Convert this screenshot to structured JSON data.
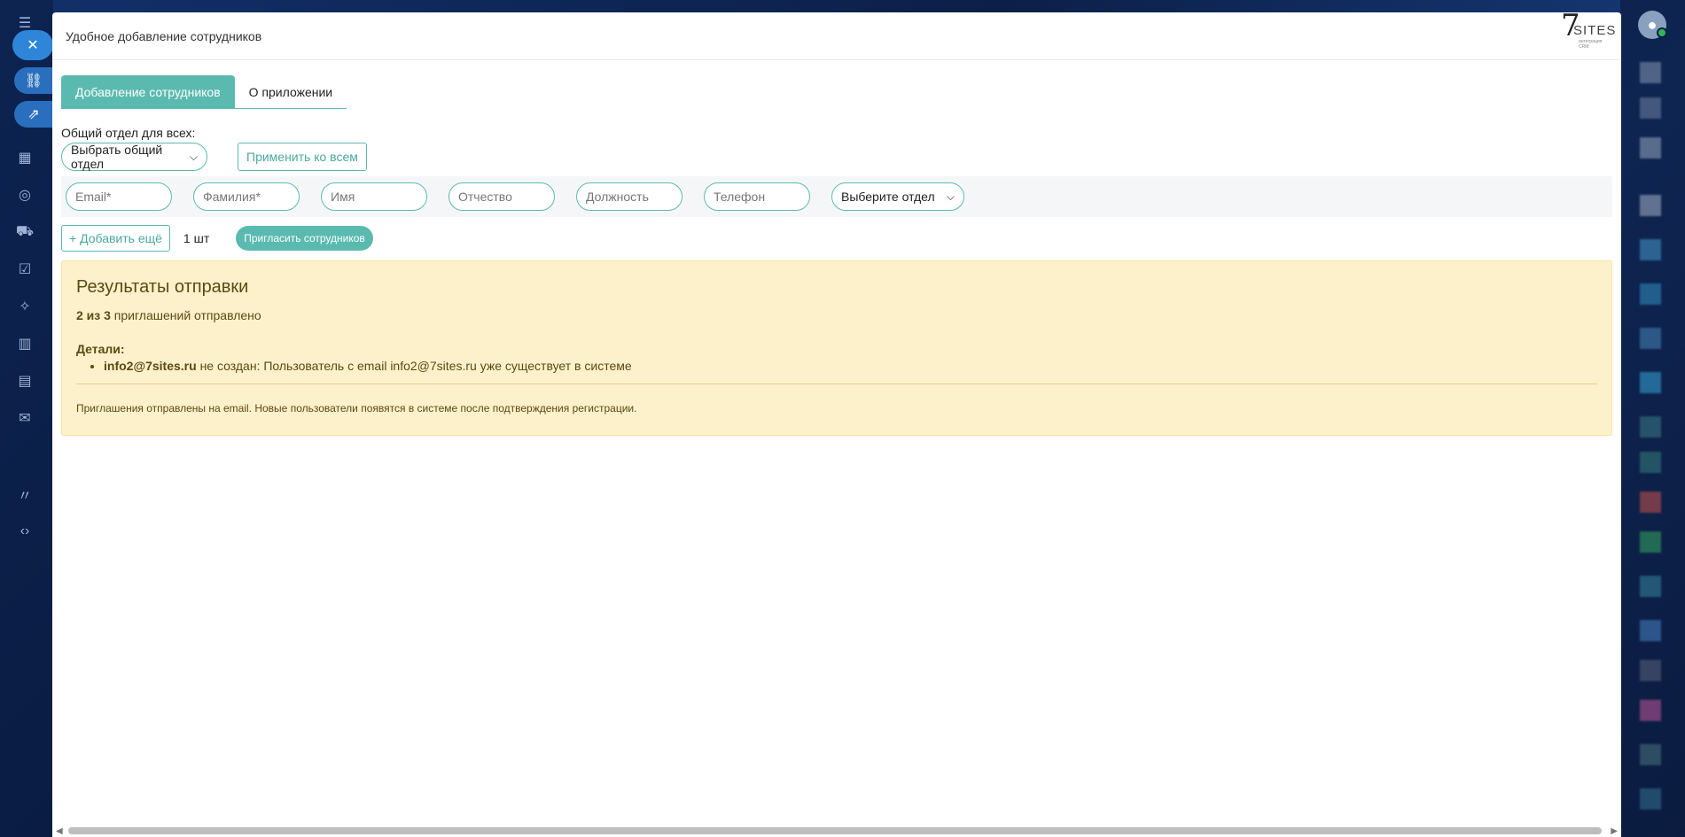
{
  "modal": {
    "title": "Удобное добавление сотрудников",
    "logo": {
      "number": "7",
      "text": "SITES",
      "subtitle": "интеграция CRM"
    }
  },
  "tabs": [
    {
      "label": "Добавление сотрудников",
      "active": true
    },
    {
      "label": "О приложении",
      "active": false
    }
  ],
  "common_department": {
    "label": "Общий отдел для всех:",
    "select_value": "Выбрать общий отдел",
    "apply_label": "Применить ко всем"
  },
  "fields": {
    "email": "Email*",
    "last_name": "Фамилия*",
    "first_name": "Имя",
    "middle_name": "Отчество",
    "position": "Должность",
    "phone": "Телефон",
    "department": "Выберите отдел"
  },
  "actions": {
    "add_more": "+ Добавить ещё",
    "count": "1 шт",
    "invite": "Пригласить сотрудников"
  },
  "result": {
    "title": "Результаты отправки",
    "summary_bold": "2 из 3",
    "summary_text": " приглашений отправлено",
    "details_title": "Детали:",
    "details": [
      {
        "email": "info2@7sites.ru",
        "message": " не создан: Пользователь с email info2@7sites.ru уже существует в системе"
      }
    ],
    "note": "Приглашения отправлены на email. Новые пользователи появятся в системе после подтверждения регистрации."
  },
  "colors": {
    "accent": "#5bbab0",
    "result_bg": "#fdf1cc",
    "result_text": "#5a4a10"
  }
}
